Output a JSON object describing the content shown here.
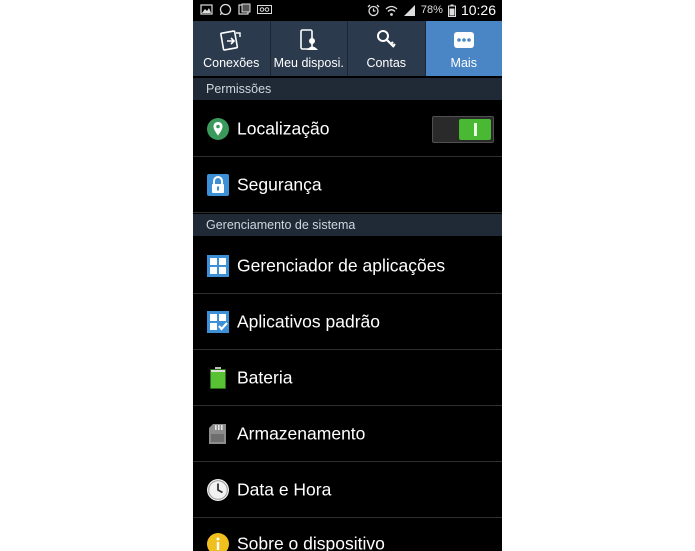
{
  "status_bar": {
    "battery_percent": "78%",
    "time": "10:26",
    "left_icons": [
      "gallery-icon",
      "whatsapp-icon",
      "photo-icon",
      "voicemail-icon"
    ],
    "right_icons": [
      "alarm-icon",
      "wifi-icon",
      "signal-icon",
      "battery-icon"
    ]
  },
  "tabs": [
    {
      "label": "Conexões",
      "icon": "connections-icon",
      "active": false
    },
    {
      "label": "Meu disposi.",
      "icon": "device-icon",
      "active": false
    },
    {
      "label": "Contas",
      "icon": "key-icon",
      "active": false
    },
    {
      "label": "Mais",
      "icon": "more-icon",
      "active": true
    }
  ],
  "sections": {
    "permissions": "Permissões",
    "system": "Gerenciamento de sistema"
  },
  "items": {
    "location": {
      "label": "Localização",
      "toggle_on": true
    },
    "security": {
      "label": "Segurança"
    },
    "app_manager": {
      "label": "Gerenciador de aplicações"
    },
    "default_apps": {
      "label": "Aplicativos padrão"
    },
    "battery": {
      "label": "Bateria"
    },
    "storage": {
      "label": "Armazenamento"
    },
    "date_time": {
      "label": "Data e Hora"
    },
    "about": {
      "label": "Sobre o dispositivo"
    }
  },
  "colors": {
    "tab_bar": "#2b3a4d",
    "tab_active": "#4a86c5",
    "section_bg": "#1f2a36",
    "toggle_on": "#49b832"
  }
}
